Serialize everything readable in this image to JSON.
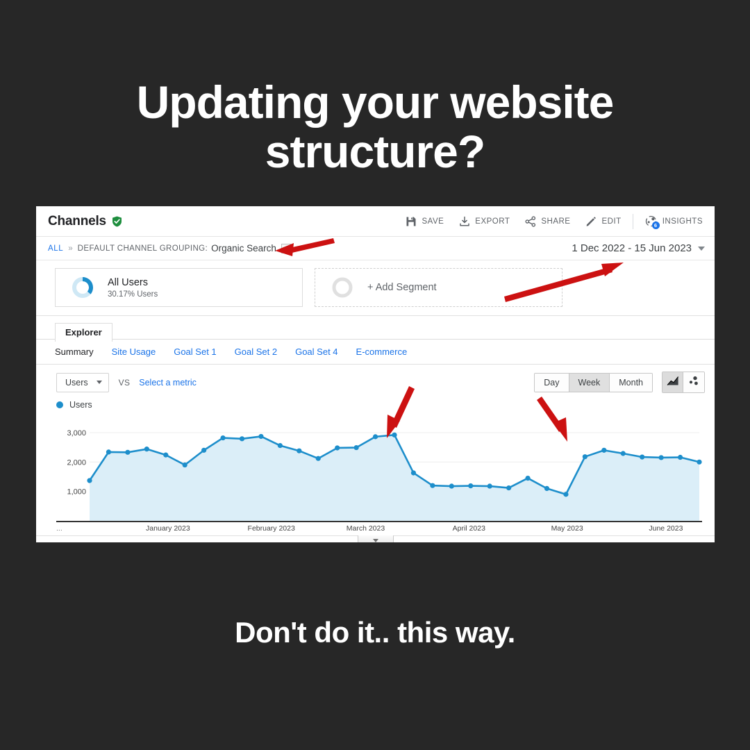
{
  "poster": {
    "headline_line1": "Updating your website",
    "headline_line2": "structure?",
    "caption": "Don't do it.. this way.",
    "background": "#272727",
    "text_color": "#ffffff"
  },
  "report": {
    "title": "Channels",
    "verified_icon": "green-shield-check-icon",
    "toolbar": [
      {
        "label": "SAVE",
        "icon": "save-icon"
      },
      {
        "label": "EXPORT",
        "icon": "download-icon"
      },
      {
        "label": "SHARE",
        "icon": "share-icon"
      },
      {
        "label": "EDIT",
        "icon": "pencil-icon"
      },
      {
        "label": "INSIGHTS",
        "icon": "insights-icon",
        "badge": "6"
      }
    ],
    "breadcrumb": {
      "root": "ALL",
      "separator": "»",
      "dimension_label": "DEFAULT CHANNEL GROUPING:",
      "dimension_value": "Organic Search",
      "caret_icon": "chevron-down-icon"
    },
    "date_range": {
      "value": "1 Dec 2022 - 15 Jun 2023",
      "caret_icon": "chevron-down-icon"
    },
    "segments": [
      {
        "name": "All Users",
        "sub": "30.17% Users",
        "icon": "donut-chart-icon",
        "percent": 30.17
      },
      {
        "name": "+ Add Segment",
        "icon": "empty-circle-icon"
      }
    ],
    "explorer_tab": "Explorer",
    "sub_tabs": [
      {
        "label": "Summary",
        "active": true
      },
      {
        "label": "Site Usage",
        "active": false
      },
      {
        "label": "Goal Set 1",
        "active": false
      },
      {
        "label": "Goal Set 2",
        "active": false
      },
      {
        "label": "Goal Set 4",
        "active": false
      },
      {
        "label": "E-commerce",
        "active": false
      }
    ],
    "metric_bar": {
      "metric": "Users",
      "vs": "VS",
      "select_metric": "Select a metric",
      "granularity": [
        {
          "label": "Day",
          "active": false
        },
        {
          "label": "Week",
          "active": true
        },
        {
          "label": "Month",
          "active": false
        }
      ],
      "chart_types": [
        {
          "icon": "line-chart-icon",
          "active": true
        },
        {
          "icon": "motion-chart-icon",
          "active": false
        }
      ]
    },
    "legend": {
      "label": "Users",
      "color": "#1d8ecb"
    },
    "collapse_handle_icon": "chevron-down-icon"
  },
  "chart_data": {
    "type": "area",
    "title": "",
    "series_name": "Users",
    "line_color": "#1d8ecb",
    "fill_color": "#dbeef8",
    "xlabel": "",
    "ylabel": "Users",
    "ylim": [
      0,
      3400
    ],
    "yticks": [
      1000,
      2000,
      3000
    ],
    "ytick_labels": [
      "1,000",
      "2,000",
      "3,000"
    ],
    "grid": true,
    "legend_position": "top-left",
    "xtick_labels": [
      "...",
      "January 2023",
      "February 2023",
      "March 2023",
      "April 2023",
      "May 2023",
      "June 2023"
    ],
    "xtick_positions_pct": [
      0,
      17.3,
      33.3,
      47.9,
      63.9,
      79.1,
      94.4
    ],
    "values": [
      1370,
      2340,
      2330,
      2440,
      2240,
      1900,
      2400,
      2820,
      2790,
      2870,
      2560,
      2380,
      2120,
      2480,
      2490,
      2860,
      2920,
      1630,
      1200,
      1180,
      1190,
      1180,
      1120,
      1450,
      1100,
      900,
      2180,
      2400,
      2290,
      2170,
      2150,
      2160,
      2000
    ],
    "annotations": [
      {
        "text": "",
        "type": "red-arrow",
        "points_to": "drop-after-march-peak"
      },
      {
        "text": "",
        "type": "red-arrow",
        "points_to": "recovery-in-may"
      },
      {
        "text": "",
        "type": "red-arrow",
        "points_to": "channel-grouping-selector"
      },
      {
        "text": "",
        "type": "red-arrow",
        "points_to": "date-range-selector"
      }
    ]
  }
}
